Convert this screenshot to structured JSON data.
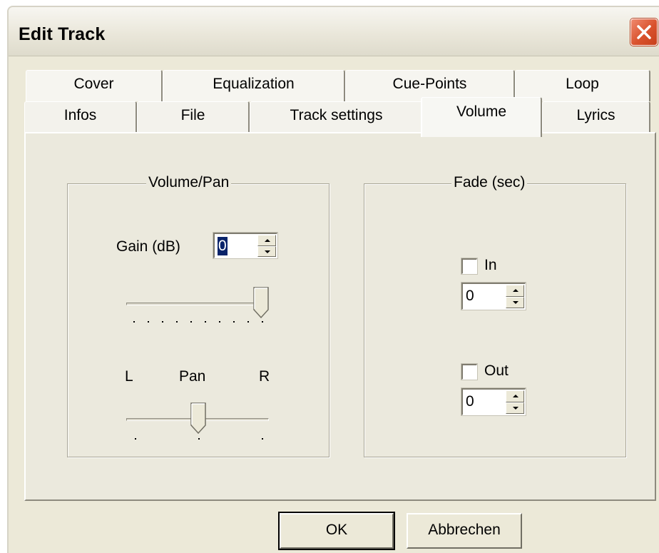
{
  "window": {
    "title": "Edit Track"
  },
  "tabs": {
    "row1": [
      {
        "label": "Cover"
      },
      {
        "label": "Equalization"
      },
      {
        "label": "Cue-Points"
      },
      {
        "label": "Loop"
      }
    ],
    "row2": [
      {
        "label": "Infos"
      },
      {
        "label": "File"
      },
      {
        "label": "Track settings"
      },
      {
        "label": "Volume",
        "active": true
      },
      {
        "label": "Lyrics"
      }
    ]
  },
  "volume_pan": {
    "legend": "Volume/Pan",
    "gain_label": "Gain (dB)",
    "gain_value": "0",
    "gain_slider_level": 1.0,
    "pan_left_label": "L",
    "pan_label": "Pan",
    "pan_right_label": "R",
    "pan_slider_level": 0.5
  },
  "fade": {
    "legend": "Fade (sec)",
    "in_label": "In",
    "in_checked": false,
    "in_value": "0",
    "out_label": "Out",
    "out_checked": false,
    "out_value": "0"
  },
  "buttons": {
    "ok_label": "OK",
    "cancel_label": "Abbrechen"
  },
  "icons": {
    "close": "close-icon",
    "spin_up": "spin-up-icon",
    "spin_down": "spin-down-icon",
    "slider_thumb": "slider-thumb-icon"
  },
  "colors": {
    "dialog_face": "#ece9d8",
    "close_button": "#d9522d",
    "selection": "#0a246a"
  }
}
